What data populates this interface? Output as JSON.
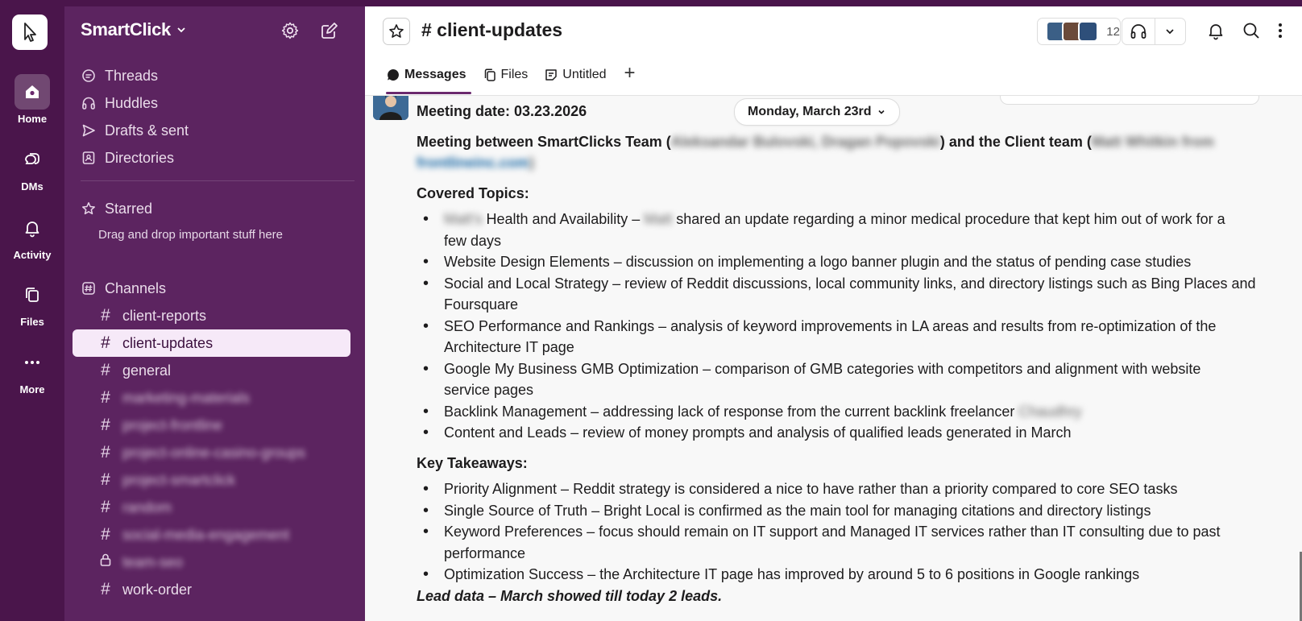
{
  "workspace": {
    "name": "SmartClick"
  },
  "rail": {
    "items": [
      {
        "label": "Home",
        "icon": "home-icon"
      },
      {
        "label": "DMs",
        "icon": "dms-icon"
      },
      {
        "label": "Activity",
        "icon": "bell-icon"
      },
      {
        "label": "Files",
        "icon": "files-icon"
      },
      {
        "label": "More",
        "icon": "more-icon"
      }
    ]
  },
  "sidebar": {
    "nav": [
      {
        "label": "Threads",
        "icon": "threads-icon"
      },
      {
        "label": "Huddles",
        "icon": "headphones-icon"
      },
      {
        "label": "Drafts & sent",
        "icon": "send-icon"
      },
      {
        "label": "Directories",
        "icon": "directory-icon"
      }
    ],
    "starred": {
      "label": "Starred",
      "hint": "Drag and drop important stuff here"
    },
    "channels_label": "Channels",
    "channels": [
      {
        "name": "client-reports",
        "blurred": false
      },
      {
        "name": "client-updates",
        "blurred": false,
        "active": true
      },
      {
        "name": "general",
        "blurred": false
      },
      {
        "name": "marketing-materials",
        "blurred": true
      },
      {
        "name": "project-frontline",
        "blurred": true
      },
      {
        "name": "project-online-casino-groups",
        "blurred": true
      },
      {
        "name": "project-smartclick",
        "blurred": true
      },
      {
        "name": "random",
        "blurred": true
      },
      {
        "name": "social-media-engagement",
        "blurred": true
      },
      {
        "name": "team-seo",
        "blurred": true,
        "private": true
      },
      {
        "name": "work-order",
        "blurred": false
      }
    ]
  },
  "header": {
    "channel_title": "# client-updates",
    "member_count": "12",
    "tabs": [
      {
        "label": "Messages",
        "active": true
      },
      {
        "label": "Files"
      },
      {
        "label": "Untitled"
      }
    ],
    "add_tab": "+"
  },
  "message": {
    "date_pill": "Monday, March 23rd",
    "meeting_date": "Meeting date: 03.23.2026",
    "intro_a": "Meeting between SmartClicks Team (",
    "intro_redact_1": "Aleksandar Bulovski, Dragan Popovski",
    "intro_b": ") and the Client team (",
    "intro_redact_2": "Matt Whitkin from",
    "intro_redact_link": "frontlineinc.com",
    "intro_c": ")",
    "covered_title": "Covered Topics:",
    "covered": [
      {
        "pre_redact": "Matt's",
        "text_a": " Health and Availability – ",
        "mid_redact": "Matt",
        "text_b": " shared an update regarding a minor medical procedure that kept him out of work for a",
        "cont": "few days"
      },
      {
        "text": "Website Design Elements – discussion on implementing a logo banner plugin and the status of pending case studies"
      },
      {
        "text": "Social and Local Strategy – review of Reddit discussions, local community links, and directory listings such as Bing Places and",
        "cont": "Foursquare"
      },
      {
        "text": "SEO Performance and Rankings – analysis of keyword improvements in LA areas and results from re-optimization of the",
        "cont": "Architecture IT page"
      },
      {
        "text": "Google My Business GMB Optimization – comparison of GMB categories with competitors and alignment with website",
        "cont": "service pages"
      },
      {
        "text": "Backlink Management – addressing lack of response from the current backlink freelancer ",
        "end_redact": "Chaudhry"
      },
      {
        "text": "Content and Leads – review of money prompts and analysis of qualified leads generated in March"
      }
    ],
    "takeaways_title": "Key Takeaways:",
    "takeaways": [
      {
        "text": "Priority Alignment – Reddit strategy is considered a nice to have rather than a priority compared to core SEO tasks"
      },
      {
        "text": "Single Source of Truth – Bright Local is confirmed as the main tool for managing citations and directory listings"
      },
      {
        "text": "Keyword Preferences – focus should remain on IT support and Managed IT services rather than IT consulting due to past",
        "cont": "performance"
      },
      {
        "text": "Optimization Success – the Architecture IT page has improved by around 5 to 6 positions in Google rankings"
      }
    ],
    "lead_line": "Lead data – March showed till today 2 leads."
  }
}
